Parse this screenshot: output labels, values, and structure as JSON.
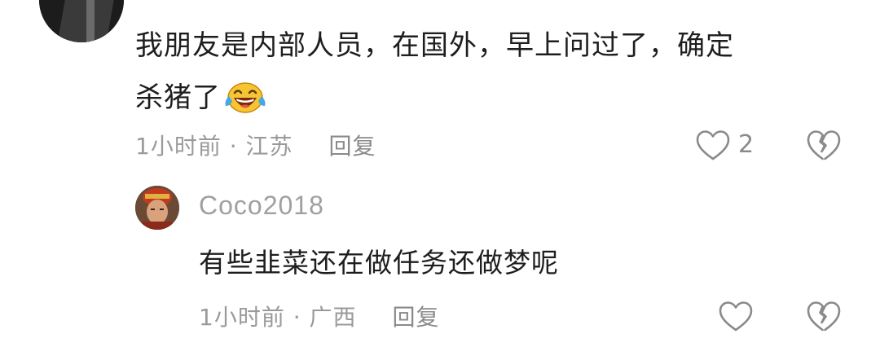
{
  "comment": {
    "text_line1": "我朋友是内部人员，在国外，早上问过了，确定",
    "text_line2": "杀猪了",
    "emoji": "laughing-tears-icon",
    "time_location": "1小时前 · 江苏",
    "reply_label": "回复",
    "like_count": "2"
  },
  "reply": {
    "username": "Coco2018",
    "text": "有些韭菜还在做任务还做梦呢",
    "time_location": "1小时前 · 广西",
    "reply_label": "回复"
  },
  "colors": {
    "meta": "#9a9a9a",
    "text": "#1e1e1e",
    "emoji_face": "#f7c531"
  }
}
